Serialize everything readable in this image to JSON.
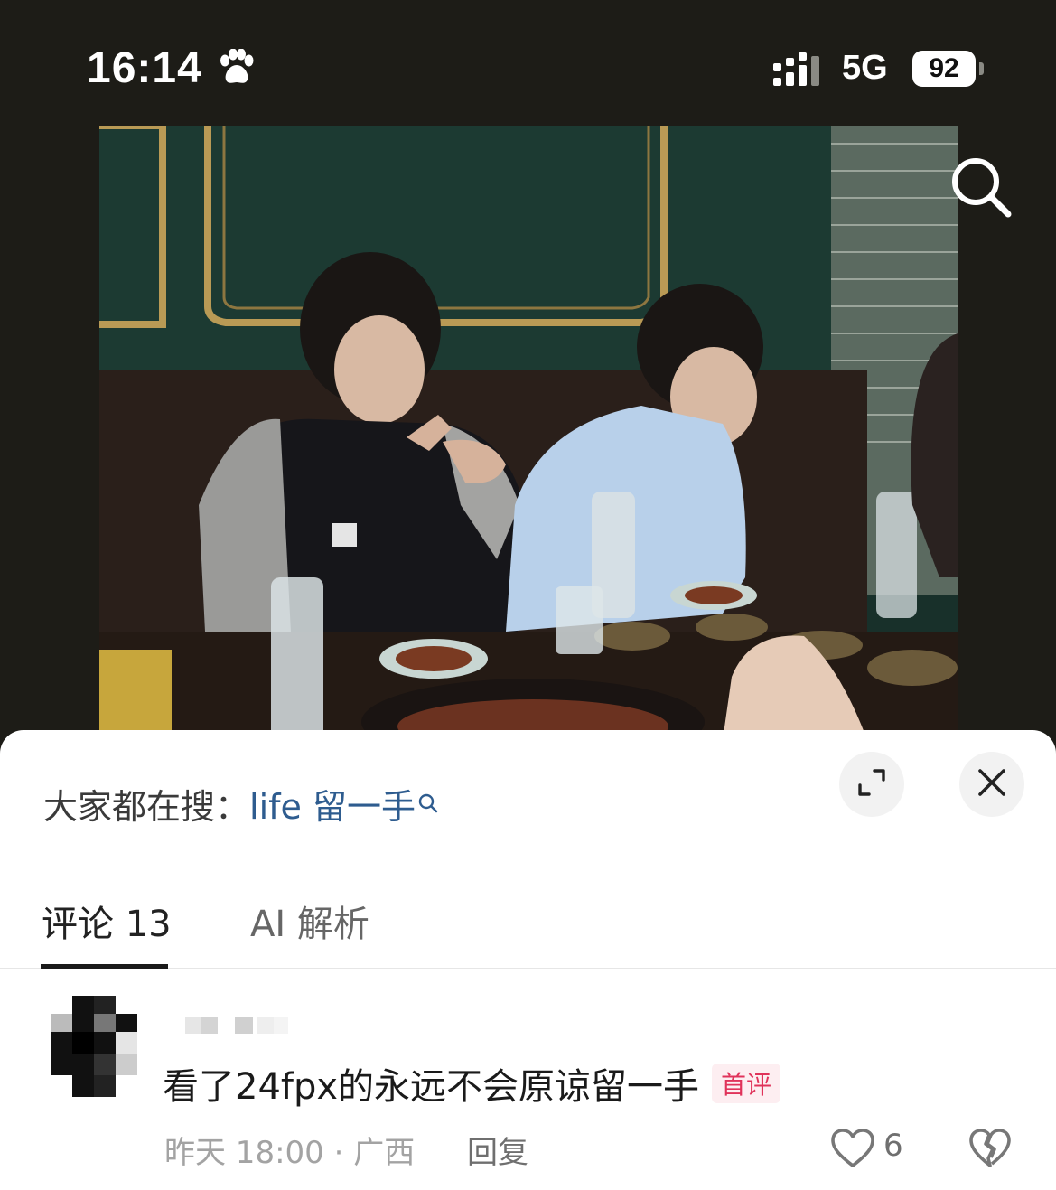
{
  "status_bar": {
    "time": "16:14",
    "network": "5G",
    "battery": "92"
  },
  "search_prompt": {
    "label": "大家都在搜：",
    "keyword": "life 留一手"
  },
  "tabs": {
    "comments_label": "评论 13",
    "ai_label": "AI 解析"
  },
  "comment": {
    "text": "看了24fpx的永远不会原谅留一手",
    "badge": "首评",
    "meta": "昨天 18:00 · 广西",
    "reply_label": "回复",
    "like_count": "6"
  },
  "colors": {
    "keyword": "#2e5c8f",
    "badge": "#e0335a",
    "background_dark": "#1d1c17"
  }
}
